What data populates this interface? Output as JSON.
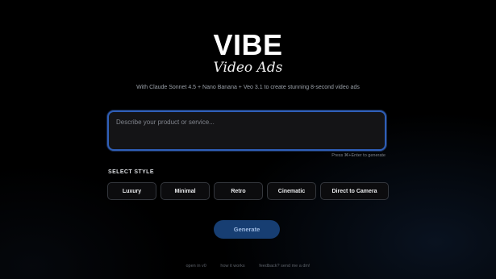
{
  "header": {
    "title": "VIBE",
    "subtitle": "Video Ads",
    "tagline": "With Claude Sonnet 4.5 + Nano Banana + Veo 3.1 to create stunning 8-second video ads"
  },
  "prompt": {
    "value": "",
    "placeholder": "Describe your product or service...",
    "hint": "Press ⌘+Enter to generate"
  },
  "style_section": {
    "label": "SELECT STYLE",
    "options": [
      "Luxury",
      "Minimal",
      "Retro",
      "Cinematic",
      "Direct to Camera"
    ]
  },
  "actions": {
    "generate_label": "Generate"
  },
  "footer": {
    "links": [
      "open in v0",
      "how it works",
      "feedback? send me a dm!"
    ]
  },
  "colors": {
    "background": "#000000",
    "prompt_border": "#2f5fb8",
    "generate_bg": "#173e72",
    "generate_text": "#9bb7df"
  }
}
